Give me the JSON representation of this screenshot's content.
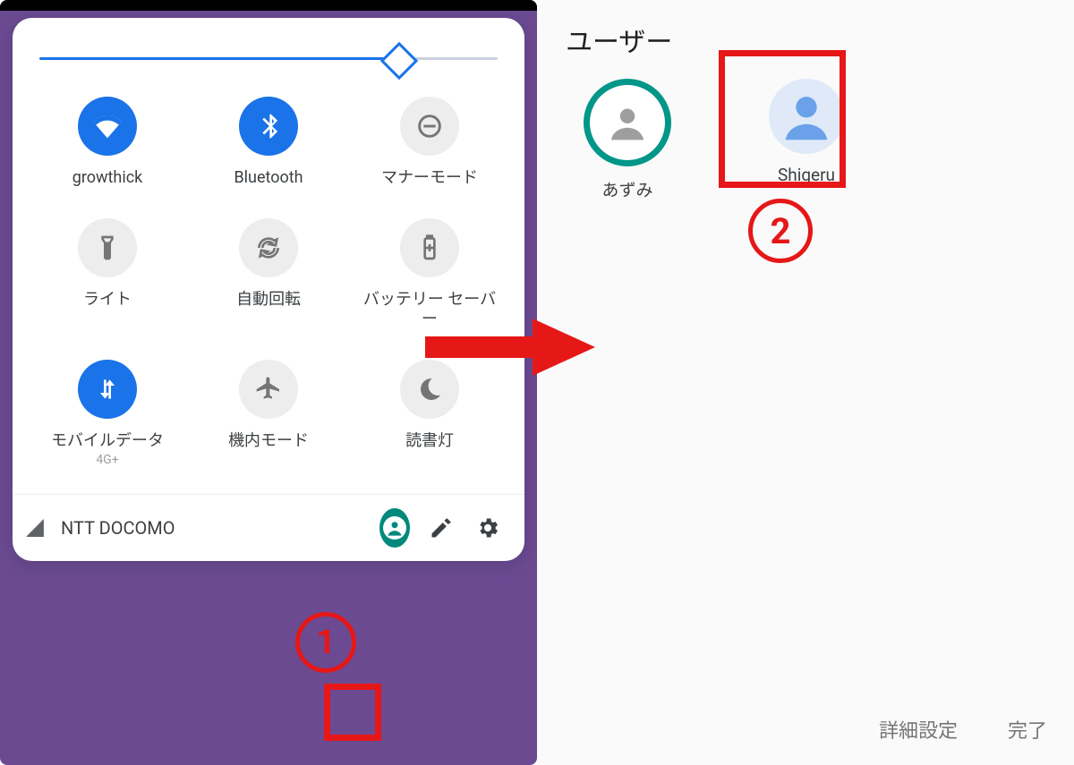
{
  "qs": {
    "brightness_pct": 78,
    "tiles": [
      {
        "id": "wifi",
        "label": "growthick",
        "active": true
      },
      {
        "id": "bluetooth",
        "label": "Bluetooth",
        "active": true
      },
      {
        "id": "dnd",
        "label": "マナーモード",
        "active": false
      },
      {
        "id": "flashlight",
        "label": "ライト",
        "active": false
      },
      {
        "id": "rotation",
        "label": "自動回転",
        "active": false
      },
      {
        "id": "battery",
        "label": "バッテリー セーバー",
        "active": false
      },
      {
        "id": "mobile",
        "label": "モバイルデータ",
        "sub": "4G+",
        "active": true
      },
      {
        "id": "airplane",
        "label": "機内モード",
        "active": false
      },
      {
        "id": "readlight",
        "label": "読書灯",
        "active": false
      }
    ],
    "carrier": "NTT DOCOMO"
  },
  "users_screen": {
    "title": "ユーザー",
    "users": [
      {
        "name": "あずみ",
        "current": true
      },
      {
        "name": "Shigeru",
        "current": false
      }
    ],
    "advanced": "詳細設定",
    "done": "完了"
  },
  "callouts": {
    "1": "1",
    "2": "2"
  }
}
